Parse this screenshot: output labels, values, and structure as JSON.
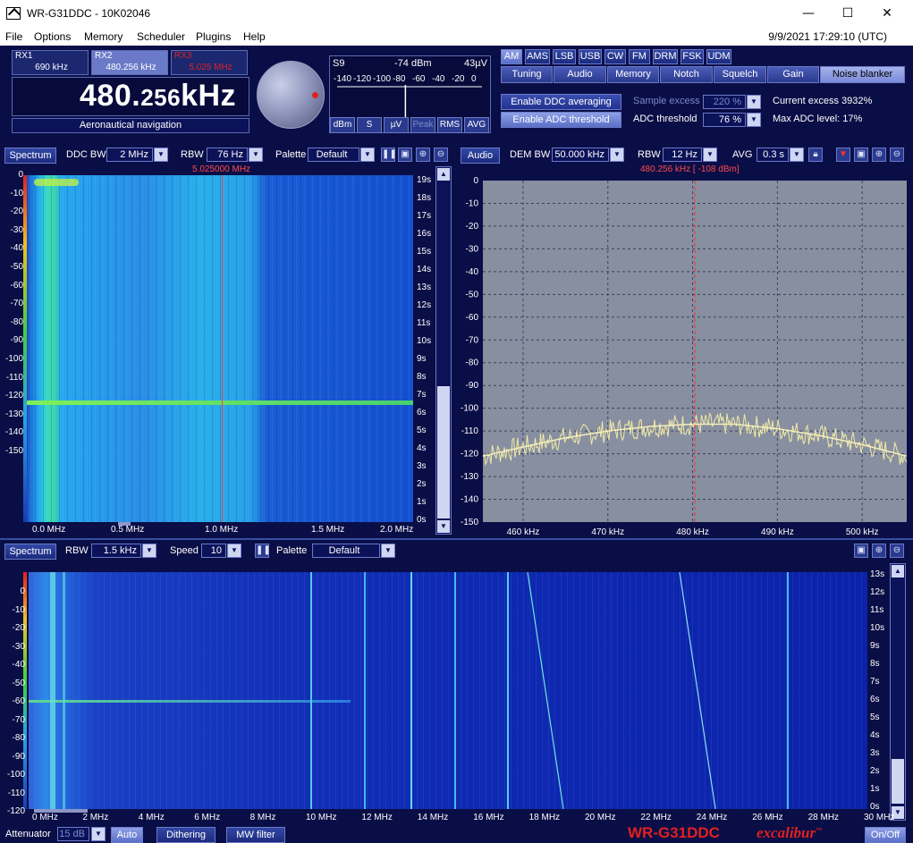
{
  "window": {
    "title": "WR-G31DDC - 10K02046",
    "minimize": "—",
    "maximize": "☐",
    "close": "✕"
  },
  "menu": {
    "items": [
      "File",
      "Options",
      "Memory",
      "Scheduler",
      "Plugins",
      "Help"
    ],
    "clock": "9/9/2021 17:29:10 (UTC)"
  },
  "receivers": [
    {
      "name": "RX1",
      "freq": "690 kHz",
      "color": "#ffffff"
    },
    {
      "name": "RX2",
      "freq": "480.256 kHz",
      "color": "#ffffff"
    },
    {
      "name": "RX3",
      "freq": "5.025 MHz",
      "color": "#e02020"
    }
  ],
  "frequency": {
    "main": "480.",
    "small": "256",
    "unit": "kHz",
    "mode_label": "Aeronautical navigation"
  },
  "smeter": {
    "s_label": "S9",
    "dbm": "-74 dBm",
    "uv": "43µV",
    "scale": [
      "-140",
      "-120",
      "-100",
      "-80",
      "-60",
      "-40",
      "-20",
      "0"
    ],
    "level_db": -74,
    "buttons": [
      "dBm",
      "S",
      "µV",
      "Peak",
      "RMS",
      "AVG"
    ]
  },
  "modes": [
    "AM",
    "AMS",
    "LSB",
    "USB",
    "CW",
    "FM",
    "DRM",
    "FSK",
    "UDM"
  ],
  "active_mode": "AM",
  "tabs": [
    "Tuning",
    "Audio",
    "Memory",
    "Notch",
    "Squelch",
    "Gain",
    "Noise blanker"
  ],
  "active_tab": "Noise blanker",
  "noise_blanker": {
    "ddc_avg_button": "Enable DDC averaging",
    "adc_threshold_button": "Enable ADC threshold",
    "sample_excess_label": "Sample excess",
    "sample_excess_value": "220 %",
    "adc_threshold_label": "ADC threshold",
    "adc_threshold_value": "76 %",
    "current_excess": "Current excess 3932%",
    "max_adc": "Max ADC level: 17%"
  },
  "ddc_panel": {
    "mode_button": "Spectrum",
    "ddc_bw_label": "DDC BW",
    "ddc_bw_value": "2 MHz",
    "rbw_label": "RBW",
    "rbw_value": "76 Hz",
    "palette_label": "Palette",
    "palette_value": "Default",
    "marker": "5.025000 MHz",
    "y_ticks": [
      "0",
      "-10",
      "-20",
      "-30",
      "-40",
      "-50",
      "-60",
      "-70",
      "-80",
      "-90",
      "-100",
      "-110",
      "-120",
      "-130",
      "-140",
      "-150"
    ],
    "x_ticks": [
      "0.0 MHz",
      "0.5 MHz",
      "1.0 MHz",
      "1.5 MHz",
      "2.0 MHz"
    ],
    "time_ticks": [
      "19s",
      "18s",
      "17s",
      "16s",
      "15s",
      "14s",
      "13s",
      "12s",
      "11s",
      "10s",
      "9s",
      "8s",
      "7s",
      "6s",
      "5s",
      "4s",
      "3s",
      "2s",
      "1s",
      "0s"
    ]
  },
  "audio_panel": {
    "mode_button": "Audio",
    "dem_bw_label": "DEM BW",
    "dem_bw_value": "50.000 kHz",
    "rbw_label": "RBW",
    "rbw_value": "12 Hz",
    "avg_label": "AVG",
    "avg_value": "0.3 s",
    "marker": "480.256 kHz [ -108 dBm]"
  },
  "wide_panel": {
    "mode_button": "Spectrum",
    "rbw_label": "RBW",
    "rbw_value": "1.5 kHz",
    "speed_label": "Speed",
    "speed_value": "10",
    "palette_label": "Palette",
    "palette_value": "Default",
    "y_ticks": [
      "0",
      "-10",
      "-20",
      "-30",
      "-40",
      "-50",
      "-60",
      "-70",
      "-80",
      "-90",
      "-100",
      "-110",
      "-120"
    ],
    "x_ticks": [
      "0 MHz",
      "2 MHz",
      "4 MHz",
      "6 MHz",
      "8 MHz",
      "10 MHz",
      "12 MHz",
      "14 MHz",
      "16 MHz",
      "18 MHz",
      "20 MHz",
      "22 MHz",
      "24 MHz",
      "26 MHz",
      "28 MHz",
      "30 MHz"
    ],
    "time_ticks": [
      "13s",
      "12s",
      "11s",
      "10s",
      "9s",
      "8s",
      "7s",
      "6s",
      "5s",
      "4s",
      "3s",
      "2s",
      "1s",
      "0s"
    ]
  },
  "bottom": {
    "attenuator_label": "Attenuator",
    "attenuator_value": "15 dB",
    "auto": "Auto",
    "dithering": "Dithering",
    "mw_filter": "MW filter",
    "onoff": "On/Off",
    "logo_model": "WR-G31DDC",
    "logo_name": "excalibur",
    "logo_tm": "™"
  },
  "chart_data": [
    {
      "type": "line",
      "title": "",
      "xlabel": "",
      "ylabel": "",
      "x_ticks": [
        "460 kHz",
        "470 kHz",
        "480 kHz",
        "490 kHz",
        "500 kHz"
      ],
      "y_ticks": [
        "0",
        "-10",
        "-20",
        "-30",
        "-40",
        "-50",
        "-60",
        "-70",
        "-80",
        "-90",
        "-100",
        "-110",
        "-120",
        "-130",
        "-140",
        "-150"
      ],
      "xlim": [
        455.256,
        505.256
      ],
      "ylim": [
        -150,
        0
      ],
      "grid": true,
      "marker_x": 480.256,
      "series": [
        {
          "x": [
            455.3,
            460,
            465,
            470,
            475,
            480,
            485,
            490,
            495,
            500,
            505.2
          ],
          "values": [
            -121,
            -117,
            -113,
            -110,
            -108,
            -107,
            -107,
            -109,
            -112,
            -116,
            -121
          ]
        }
      ]
    }
  ]
}
